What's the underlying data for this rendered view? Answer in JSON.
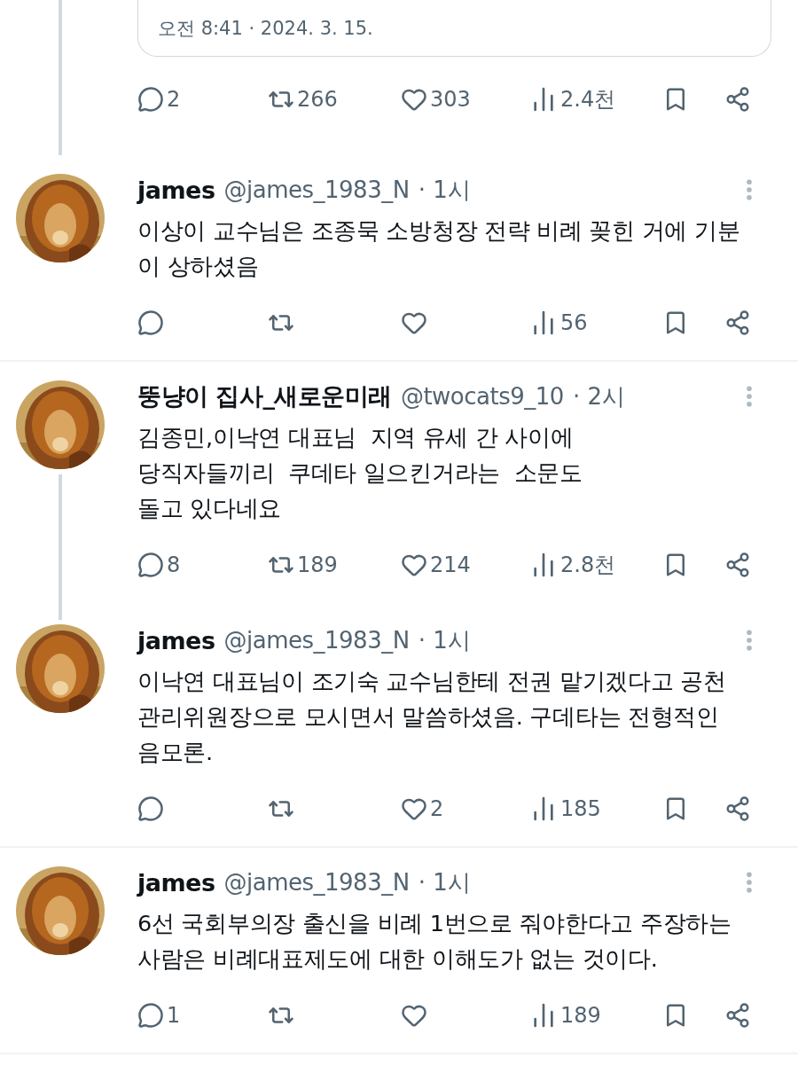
{
  "quoted_card": {
    "timestamp": "오전 8:41 · 2024. 3. 15."
  },
  "main_actions": [
    {
      "kind": "reply",
      "count": "2"
    },
    {
      "kind": "repost",
      "count": "266"
    },
    {
      "kind": "like",
      "count": "303"
    },
    {
      "kind": "views",
      "count": "2.4천"
    },
    {
      "kind": "bookmark"
    },
    {
      "kind": "share"
    }
  ],
  "replies": [
    {
      "avatar": {
        "kind": "picture"
      },
      "name": "james",
      "handle": "@james_1983_N",
      "time": "· 1시",
      "thread_below": false,
      "divider": true,
      "lines": [
        "이상이 교수님은 조종묵 소방청장 전략 비례 꽂힌 거에 기분",
        "이 상하셨음"
      ],
      "actions": [
        {
          "kind": "reply"
        },
        {
          "kind": "repost"
        },
        {
          "kind": "like"
        },
        {
          "kind": "views",
          "count": "56"
        },
        {
          "kind": "bookmark"
        },
        {
          "kind": "share"
        }
      ]
    },
    {
      "avatar": {
        "kind": "picture"
      },
      "name": "뚱냥이 집사_새로운미래",
      "handle": "@twocats9_10",
      "time": "· 2시",
      "thread_below": true,
      "divider": false,
      "lines": [
        "김종민,이낙연 대표님  지역 유세 간 사이에",
        "당직자들끼리  쿠데타 일으킨거라는  소문도",
        "돌고 있다네요"
      ],
      "actions": [
        {
          "kind": "reply",
          "count": "8"
        },
        {
          "kind": "repost",
          "count": "189"
        },
        {
          "kind": "like",
          "count": "214"
        },
        {
          "kind": "views",
          "count": "2.8천"
        },
        {
          "kind": "bookmark"
        },
        {
          "kind": "share"
        }
      ]
    },
    {
      "avatar": {
        "kind": "picture"
      },
      "name": "james",
      "handle": "@james_1983_N",
      "time": "· 1시",
      "thread_below": false,
      "divider": true,
      "lines": [
        "이낙연 대표님이 조기숙 교수님한테 전권 맡기겠다고 공천",
        "관리위원장으로 모시면서 말씀하셨음. 구데타는 전형적인",
        "음모론."
      ],
      "actions": [
        {
          "kind": "reply"
        },
        {
          "kind": "repost"
        },
        {
          "kind": "like",
          "count": "2"
        },
        {
          "kind": "views",
          "count": "185"
        },
        {
          "kind": "bookmark"
        },
        {
          "kind": "share"
        }
      ]
    },
    {
      "avatar": {
        "kind": "picture"
      },
      "name": "james",
      "handle": "@james_1983_N",
      "time": "· 1시",
      "thread_below": false,
      "divider": true,
      "lines": [
        "6선 국회부의장 출신을 비례 1번으로 줘야한다고 주장하는",
        "사람은 비례대표제도에 대한 이해도가 없는 것이다."
      ],
      "actions": [
        {
          "kind": "reply",
          "count": "1"
        },
        {
          "kind": "repost"
        },
        {
          "kind": "like"
        },
        {
          "kind": "views",
          "count": "189"
        },
        {
          "kind": "bookmark"
        },
        {
          "kind": "share"
        }
      ]
    }
  ]
}
